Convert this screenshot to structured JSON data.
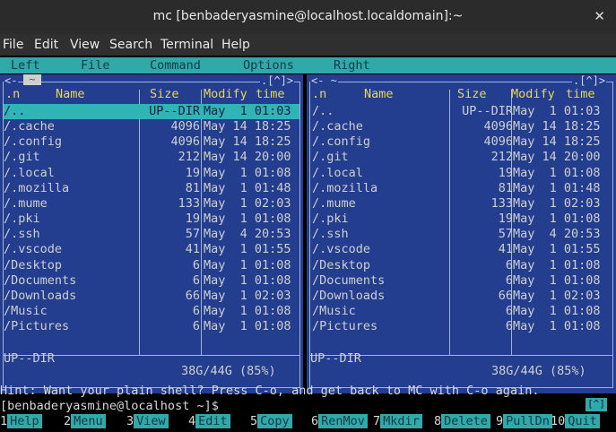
{
  "window": {
    "title": "mc [benbaderyasmine@localhost.localdomain]:~",
    "close_glyph": "✕"
  },
  "menubar": [
    "File",
    "Edit",
    "View",
    "Search",
    "Terminal",
    "Help"
  ],
  "mc_menu": [
    "Left",
    "File",
    "Command",
    "Options",
    "Right"
  ],
  "panel_glyphs": {
    "left_top_right": ".[^]>",
    "right_top_left": "<- ~",
    "right_top_right": ".[^]>",
    "left_arrow": "<-",
    "left_box": "~"
  },
  "columns": {
    "n": ".n",
    "name": "Name",
    "size": "Size",
    "modify": "Modify",
    "time": "time"
  },
  "left_panel": {
    "rows": [
      {
        "name": "/..",
        "size": "UP--DIR",
        "date": "May  1 01:03",
        "selected": true
      },
      {
        "name": "/.cache",
        "size": "4096",
        "date": "May 14 18:25"
      },
      {
        "name": "/.config",
        "size": "4096",
        "date": "May 14 18:25"
      },
      {
        "name": "/.git",
        "size": "212",
        "date": "May 14 20:00"
      },
      {
        "name": "/.local",
        "size": "19",
        "date": "May  1 01:08"
      },
      {
        "name": "/.mozilla",
        "size": "81",
        "date": "May  1 01:48"
      },
      {
        "name": "/.mume",
        "size": "133",
        "date": "May  1 02:03"
      },
      {
        "name": "/.pki",
        "size": "19",
        "date": "May  1 01:08"
      },
      {
        "name": "/.ssh",
        "size": "57",
        "date": "May  4 20:53"
      },
      {
        "name": "/.vscode",
        "size": "41",
        "date": "May  1 01:55"
      },
      {
        "name": "/Desktop",
        "size": "6",
        "date": "May  1 01:08"
      },
      {
        "name": "/Documents",
        "size": "6",
        "date": "May  1 01:08"
      },
      {
        "name": "/Downloads",
        "size": "66",
        "date": "May  1 02:03"
      },
      {
        "name": "/Music",
        "size": "6",
        "date": "May  1 01:08"
      },
      {
        "name": "/Pictures",
        "size": "6",
        "date": "May  1 01:08"
      }
    ],
    "status": "UP--DIR",
    "free": "38G/44G (85%)"
  },
  "right_panel": {
    "rows": [
      {
        "name": "/..",
        "size": "UP--DIR",
        "date": "May  1 01:03"
      },
      {
        "name": "/.cache",
        "size": "4096",
        "date": "May 14 18:25"
      },
      {
        "name": "/.config",
        "size": "4096",
        "date": "May 14 18:25"
      },
      {
        "name": "/.git",
        "size": "212",
        "date": "May 14 20:00"
      },
      {
        "name": "/.local",
        "size": "19",
        "date": "May  1 01:08"
      },
      {
        "name": "/.mozilla",
        "size": "81",
        "date": "May  1 01:48"
      },
      {
        "name": "/.mume",
        "size": "133",
        "date": "May  1 02:03"
      },
      {
        "name": "/.pki",
        "size": "19",
        "date": "May  1 01:08"
      },
      {
        "name": "/.ssh",
        "size": "57",
        "date": "May  4 20:53"
      },
      {
        "name": "/.vscode",
        "size": "41",
        "date": "May  1 01:55"
      },
      {
        "name": "/Desktop",
        "size": "6",
        "date": "May  1 01:08"
      },
      {
        "name": "/Documents",
        "size": "6",
        "date": "May  1 01:08"
      },
      {
        "name": "/Downloads",
        "size": "66",
        "date": "May  1 02:03"
      },
      {
        "name": "/Music",
        "size": "6",
        "date": "May  1 01:08"
      },
      {
        "name": "/Pictures",
        "size": "6",
        "date": "May  1 01:08"
      }
    ],
    "status": "UP--DIR",
    "free": "38G/44G (85%)"
  },
  "hint": "Hint: Want your plain shell? Press C-o, and get back to MC with C-o again.",
  "prompt": "[benbaderyasmine@localhost ~]$",
  "prompt_tag": "[^]",
  "fkeys": [
    {
      "num": "1",
      "label": "Help"
    },
    {
      "num": "2",
      "label": "Menu"
    },
    {
      "num": "3",
      "label": "View"
    },
    {
      "num": "4",
      "label": "Edit"
    },
    {
      "num": "5",
      "label": "Copy"
    },
    {
      "num": "6",
      "label": "RenMov"
    },
    {
      "num": "7",
      "label": "Mkdir"
    },
    {
      "num": "8",
      "label": "Delete"
    },
    {
      "num": "9",
      "label": "PullDn"
    },
    {
      "num": "10",
      "label": "Quit"
    }
  ],
  "colors": {
    "panel_bg": "#233e8f",
    "menu_bg": "#2fa9a9",
    "header": "#e8d65a"
  }
}
